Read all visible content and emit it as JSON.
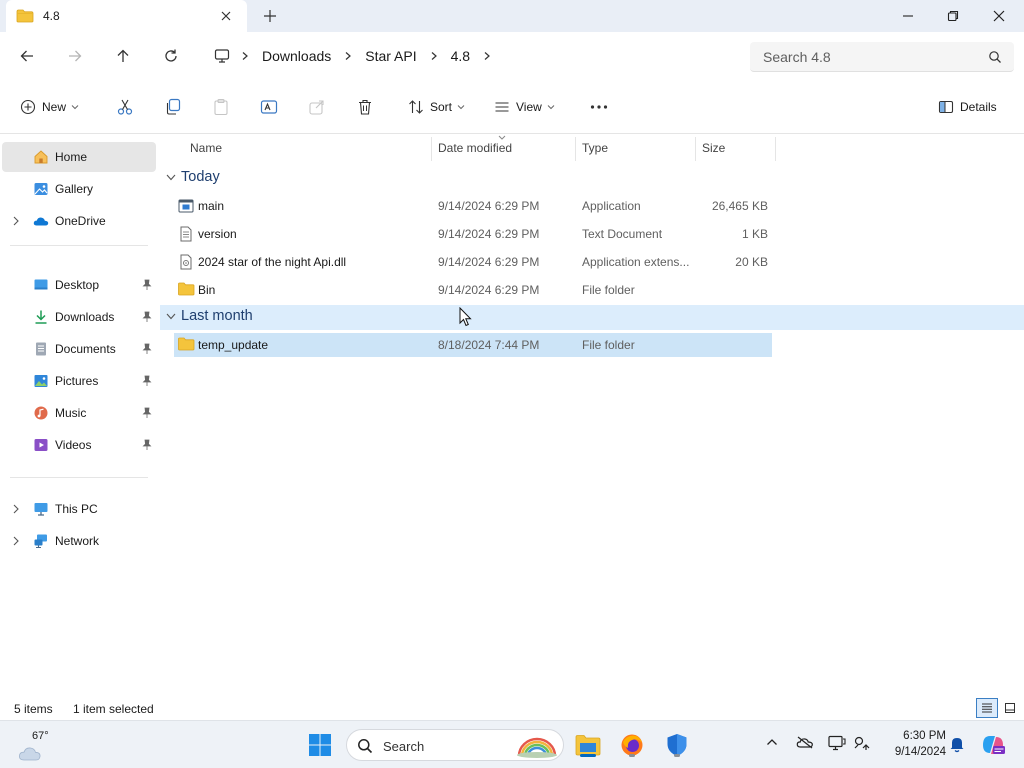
{
  "window": {
    "tab_title": "4.8"
  },
  "nav": {
    "breadcrumb": [
      "Downloads",
      "Star API",
      "4.8"
    ],
    "search_placeholder": "Search 4.8"
  },
  "commands": {
    "new_label": "New",
    "sort_label": "Sort",
    "view_label": "View",
    "details_label": "Details"
  },
  "sidebar": {
    "home": "Home",
    "gallery": "Gallery",
    "onedrive": "OneDrive",
    "desktop": "Desktop",
    "downloads": "Downloads",
    "documents": "Documents",
    "pictures": "Pictures",
    "music": "Music",
    "videos": "Videos",
    "thispc": "This PC",
    "network": "Network"
  },
  "columns": {
    "name": "Name",
    "date": "Date modified",
    "type": "Type",
    "size": "Size"
  },
  "groups": {
    "today": "Today",
    "last_month": "Last month"
  },
  "files": {
    "main": {
      "name": "main",
      "date": "9/14/2024 6:29 PM",
      "type": "Application",
      "size": "26,465 KB"
    },
    "version": {
      "name": "version",
      "date": "9/14/2024 6:29 PM",
      "type": "Text Document",
      "size": "1 KB"
    },
    "dll": {
      "name": "2024 star of the night Api.dll",
      "date": "9/14/2024 6:29 PM",
      "type": "Application extens...",
      "size": "20 KB"
    },
    "bin": {
      "name": "Bin",
      "date": "9/14/2024 6:29 PM",
      "type": "File folder",
      "size": ""
    },
    "temp": {
      "name": "temp_update",
      "date": "8/18/2024 7:44 PM",
      "type": "File folder",
      "size": ""
    }
  },
  "status": {
    "count": "5 items",
    "selection": "1 item selected"
  },
  "taskbar": {
    "temperature": "67°",
    "search_label": "Search",
    "time": "6:30 PM",
    "date": "9/14/2024"
  },
  "colors": {
    "accent": "#0067c0",
    "folder": "#f4c43c",
    "selection": "#cce4f7",
    "group_highlight": "#dcedfc"
  }
}
